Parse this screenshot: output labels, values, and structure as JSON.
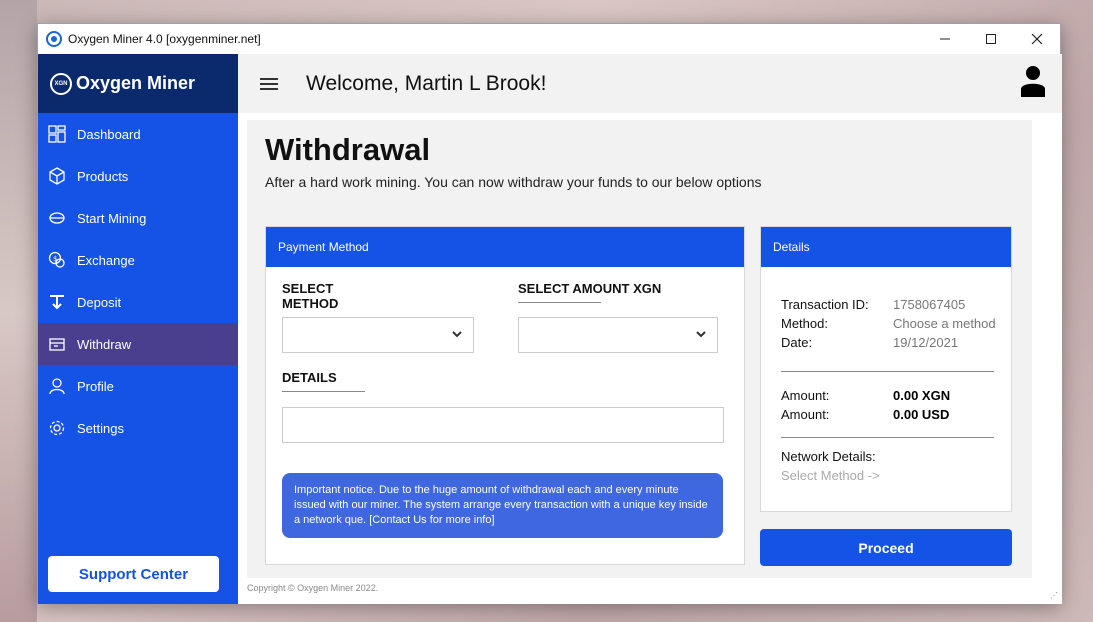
{
  "window": {
    "title": "Oxygen Miner 4.0 [oxygenminer.net]",
    "controls": {
      "minimize": "—",
      "maximize": "☐",
      "close": "✕"
    }
  },
  "brand": {
    "name": "Oxygen Miner",
    "logo_text": "XGN"
  },
  "sidebar": {
    "items": [
      {
        "label": "Dashboard",
        "icon": "dashboard-icon"
      },
      {
        "label": "Products",
        "icon": "box-icon"
      },
      {
        "label": "Start Mining",
        "icon": "mining-icon"
      },
      {
        "label": "Exchange",
        "icon": "exchange-icon"
      },
      {
        "label": "Deposit",
        "icon": "deposit-icon"
      },
      {
        "label": "Withdraw",
        "icon": "withdraw-icon",
        "active": true
      },
      {
        "label": "Profile",
        "icon": "user-icon"
      },
      {
        "label": "Settings",
        "icon": "gear-icon"
      }
    ],
    "support_label": "Support Center"
  },
  "header": {
    "welcome": "Welcome, Martin L Brook!"
  },
  "page": {
    "title": "Withdrawal",
    "subtitle": "After a hard work mining. You can now withdraw your funds to our below options"
  },
  "payment": {
    "header": "Payment Method",
    "method_label": "SELECT METHOD",
    "amount_label": "SELECT AMOUNT XGN",
    "details_label": "DETAILS",
    "method_value": "",
    "amount_value": "",
    "details_value": "",
    "notice": "Important notice. Due to the huge amount of withdrawal each and every minute issued with our miner. The system arrange every transaction with a unique key inside a network que. [Contact Us for more info]"
  },
  "details": {
    "header": "Details",
    "transaction_label": "Transaction ID:",
    "transaction_value": "1758067405",
    "method_label": "Method:",
    "method_value": "Choose a method",
    "date_label": "Date:",
    "date_value": "19/12/2021",
    "amount1_label": "Amount:",
    "amount1_value": "0.00 XGN",
    "amount2_label": "Amount:",
    "amount2_value": "0.00 USD",
    "network_label": "Network Details:",
    "network_value": "Select Method ->"
  },
  "proceed_label": "Proceed",
  "copyright": "Copyright © Oxygen Miner 2022.",
  "colors": {
    "primary": "#1553e6",
    "brand_dark": "#0b2a6e",
    "active_nav": "#4a3f8f",
    "notice": "#3e67e0"
  }
}
